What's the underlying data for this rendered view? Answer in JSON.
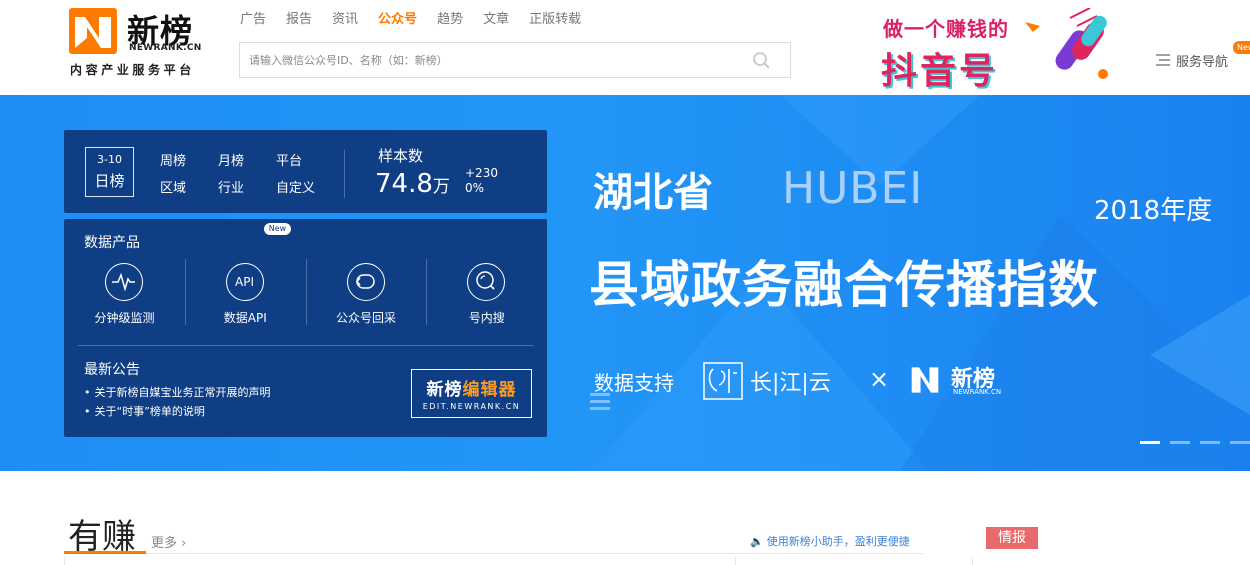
{
  "brand": {
    "name": "新榜",
    "domain": "NEWRANK.CN",
    "slogan": "内容产业服务平台",
    "accent_color": "#ff7a00"
  },
  "topnav": {
    "items": [
      {
        "label": "广告",
        "active": false
      },
      {
        "label": "报告",
        "active": false
      },
      {
        "label": "资讯",
        "active": false
      },
      {
        "label": "公众号",
        "active": true
      },
      {
        "label": "趋势",
        "active": false
      },
      {
        "label": "文章",
        "active": false
      },
      {
        "label": "正版转载",
        "active": false
      }
    ]
  },
  "search": {
    "placeholder": "请输入微信公众号ID、名称（如：新榜）",
    "value": ""
  },
  "ad": {
    "line1": "做一个赚钱的",
    "line2": "抖音号"
  },
  "service_nav": {
    "label": "服务导航",
    "badge": "New"
  },
  "rank_panel": {
    "date": "3-10",
    "period": "日榜",
    "links": [
      "周榜",
      "月榜",
      "平台",
      "区域",
      "行业",
      "自定义"
    ],
    "sample_label": "样本数",
    "sample_value": "74.8",
    "sample_unit": "万",
    "sample_delta": "+230",
    "sample_delta_pct": "0%"
  },
  "data_products": {
    "title": "数据产品",
    "items": [
      {
        "label": "分钟级监测",
        "icon": "pulse-icon"
      },
      {
        "label": "数据API",
        "icon": "api-icon",
        "badge": "New"
      },
      {
        "label": "公众号回采",
        "icon": "return-icon"
      },
      {
        "label": "号内搜",
        "icon": "search-icon"
      }
    ],
    "api_text": "API"
  },
  "announcements": {
    "title": "最新公告",
    "items": [
      "关于新榜自媒宝业务正常开展的声明",
      "关于“时事”榜单的说明"
    ]
  },
  "editor": {
    "name_part1": "新榜",
    "name_part2": "编辑器",
    "domain": "EDIT.NEWRANK.CN"
  },
  "banner": {
    "headline_cn": "湖北省",
    "headline_en": "HUBEI",
    "year": "2018年度",
    "headline2": "县域政务融合传播指数",
    "support_label": "数据支持",
    "partner_name": "长|江|云",
    "times": "×",
    "partner2_name": "新榜",
    "partner2_domain": "NEWRANK.CN",
    "slides": 4,
    "active_slide": 1
  },
  "section": {
    "title": "有赚",
    "more": "更多",
    "assistant": "使用新榜小助手，盈利更便捷",
    "intel_tag": "情报"
  }
}
